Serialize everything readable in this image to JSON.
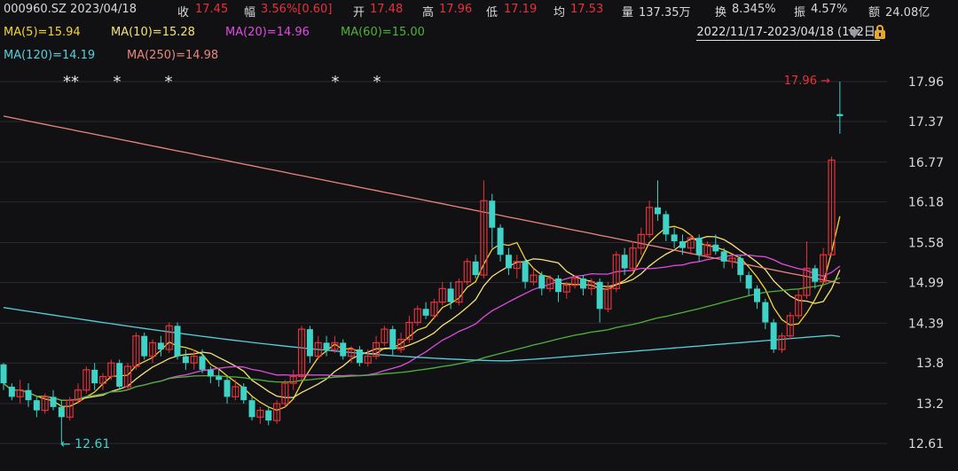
{
  "header": {
    "code_date": "000960.SZ 2023/04/18",
    "close": {
      "label": "收",
      "value": "17.45"
    },
    "change": {
      "label": "幅",
      "value": "3.56%[0.60]"
    },
    "open": {
      "label": "开",
      "value": "17.48"
    },
    "high": {
      "label": "高",
      "value": "17.96"
    },
    "low": {
      "label": "低",
      "value": "17.19"
    },
    "avg": {
      "label": "均",
      "value": "17.53"
    },
    "volume": {
      "label": "量",
      "value": "137.35万"
    },
    "turnover": {
      "label": "换",
      "value": "8.345%"
    },
    "amplitude": {
      "label": "振",
      "value": "4.57%"
    },
    "amount": {
      "label": "额",
      "value": "24.08亿"
    }
  },
  "ma_legend": [
    {
      "text": "MA(5)=15.94",
      "color": "#f3d23a"
    },
    {
      "text": "MA(10)=15.28",
      "color": "#f6e27a"
    },
    {
      "text": "MA(20)=14.96",
      "color": "#e04ce0"
    },
    {
      "text": "MA(60)=15.00",
      "color": "#4fb23a"
    },
    {
      "text": "MA(120)=14.19",
      "color": "#56d0dc"
    },
    {
      "text": "MA(250)=14.98",
      "color": "#e8877f"
    }
  ],
  "range_label": "2022/11/17-2023/04/18 (102日)",
  "colors": {
    "up": "#e8313a",
    "down": "#3fd2c7"
  },
  "chart_data": {
    "type": "candlestick",
    "y_ticks": [
      17.96,
      17.37,
      16.77,
      16.18,
      15.58,
      14.99,
      14.39,
      13.8,
      13.2,
      12.61
    ],
    "ylim": [
      12.61,
      17.96
    ],
    "high_marker": "17.96",
    "low_marker": "12.61",
    "star_labels": [
      "**",
      "*",
      "*",
      "*",
      "*"
    ],
    "candles": [
      [
        13.78,
        13.5,
        13.8,
        13.4
      ],
      [
        13.45,
        13.3,
        13.5,
        13.25
      ],
      [
        13.3,
        13.4,
        13.55,
        13.2
      ],
      [
        13.4,
        13.25,
        13.5,
        13.15
      ],
      [
        13.25,
        13.1,
        13.3,
        13.0
      ],
      [
        13.1,
        13.3,
        13.35,
        13.05
      ],
      [
        13.3,
        13.15,
        13.4,
        13.1
      ],
      [
        13.15,
        13.0,
        13.25,
        12.61
      ],
      [
        13.0,
        13.25,
        13.3,
        12.95
      ],
      [
        13.25,
        13.4,
        13.5,
        13.2
      ],
      [
        13.4,
        13.7,
        13.75,
        13.35
      ],
      [
        13.7,
        13.5,
        13.8,
        13.4
      ],
      [
        13.5,
        13.6,
        13.65,
        13.4
      ],
      [
        13.6,
        13.8,
        13.85,
        13.55
      ],
      [
        13.8,
        13.45,
        13.85,
        13.4
      ],
      [
        13.45,
        13.75,
        13.8,
        13.4
      ],
      [
        13.75,
        14.2,
        14.25,
        13.7
      ],
      [
        14.2,
        13.9,
        14.25,
        13.85
      ],
      [
        13.9,
        14.1,
        14.15,
        13.8
      ],
      [
        14.1,
        14.0,
        14.2,
        13.9
      ],
      [
        14.0,
        14.35,
        14.4,
        13.95
      ],
      [
        14.35,
        13.9,
        14.4,
        13.85
      ],
      [
        13.9,
        13.8,
        14.0,
        13.7
      ],
      [
        13.8,
        13.9,
        14.0,
        13.7
      ],
      [
        13.9,
        13.7,
        14.0,
        13.65
      ],
      [
        13.7,
        13.6,
        13.75,
        13.5
      ],
      [
        13.6,
        13.55,
        13.7,
        13.45
      ],
      [
        13.55,
        13.3,
        13.6,
        13.2
      ],
      [
        13.3,
        13.45,
        13.55,
        13.25
      ],
      [
        13.45,
        13.25,
        13.5,
        13.2
      ],
      [
        13.25,
        13.0,
        13.3,
        12.95
      ],
      [
        13.0,
        13.1,
        13.15,
        12.9
      ],
      [
        13.1,
        12.95,
        13.15,
        12.88
      ],
      [
        12.95,
        13.2,
        13.25,
        12.9
      ],
      [
        13.2,
        13.5,
        13.55,
        13.15
      ],
      [
        13.5,
        13.6,
        13.7,
        13.4
      ],
      [
        13.6,
        14.3,
        14.35,
        13.55
      ],
      [
        14.3,
        13.9,
        14.35,
        13.8
      ],
      [
        13.9,
        14.1,
        14.2,
        13.85
      ],
      [
        14.1,
        14.0,
        14.2,
        13.9
      ],
      [
        14.0,
        14.1,
        14.2,
        13.95
      ],
      [
        14.1,
        13.9,
        14.15,
        13.85
      ],
      [
        13.9,
        14.0,
        14.05,
        13.8
      ],
      [
        14.0,
        13.8,
        14.05,
        13.75
      ],
      [
        13.8,
        13.9,
        14.0,
        13.75
      ],
      [
        13.9,
        14.1,
        14.2,
        13.85
      ],
      [
        14.1,
        14.3,
        14.35,
        14.05
      ],
      [
        14.3,
        14.0,
        14.35,
        13.9
      ],
      [
        14.0,
        14.15,
        14.25,
        13.95
      ],
      [
        14.15,
        14.4,
        14.5,
        14.1
      ],
      [
        14.4,
        14.6,
        14.65,
        14.35
      ],
      [
        14.6,
        14.5,
        14.7,
        14.45
      ],
      [
        14.5,
        14.7,
        14.75,
        14.45
      ],
      [
        14.7,
        14.9,
        15.0,
        14.65
      ],
      [
        14.9,
        14.7,
        15.0,
        14.6
      ],
      [
        14.7,
        15.0,
        15.05,
        14.65
      ],
      [
        15.0,
        15.3,
        15.35,
        14.95
      ],
      [
        15.3,
        15.1,
        15.4,
        15.05
      ],
      [
        15.1,
        16.2,
        16.5,
        15.05
      ],
      [
        16.2,
        15.8,
        16.3,
        15.5
      ],
      [
        15.8,
        15.4,
        15.85,
        15.3
      ],
      [
        15.4,
        15.2,
        15.5,
        15.1
      ],
      [
        15.2,
        15.3,
        15.4,
        15.05
      ],
      [
        15.3,
        15.0,
        15.35,
        14.9
      ],
      [
        15.0,
        15.1,
        15.2,
        14.95
      ],
      [
        15.1,
        14.9,
        15.15,
        14.8
      ],
      [
        14.9,
        15.05,
        15.1,
        14.85
      ],
      [
        15.05,
        14.85,
        15.1,
        14.7
      ],
      [
        14.85,
        14.95,
        15.0,
        14.75
      ],
      [
        14.95,
        15.05,
        15.1,
        14.9
      ],
      [
        15.05,
        14.9,
        15.1,
        14.8
      ],
      [
        14.9,
        15.0,
        15.05,
        14.8
      ],
      [
        15.0,
        14.6,
        15.05,
        14.4
      ],
      [
        14.6,
        14.9,
        15.0,
        14.55
      ],
      [
        14.9,
        15.4,
        15.45,
        14.85
      ],
      [
        15.4,
        15.2,
        15.5,
        15.1
      ],
      [
        15.2,
        15.5,
        15.6,
        15.15
      ],
      [
        15.5,
        15.7,
        15.8,
        15.4
      ],
      [
        15.7,
        16.1,
        16.2,
        15.65
      ],
      [
        16.1,
        16.0,
        16.5,
        15.9
      ],
      [
        16.0,
        15.7,
        16.05,
        15.6
      ],
      [
        15.7,
        15.6,
        15.8,
        15.5
      ],
      [
        15.6,
        15.5,
        15.7,
        15.4
      ],
      [
        15.5,
        15.65,
        15.7,
        15.4
      ],
      [
        15.65,
        15.4,
        15.7,
        15.3
      ],
      [
        15.4,
        15.55,
        15.6,
        15.35
      ],
      [
        15.55,
        15.45,
        15.7,
        15.4
      ],
      [
        15.45,
        15.3,
        15.5,
        15.2
      ],
      [
        15.3,
        15.35,
        15.4,
        15.2
      ],
      [
        15.35,
        15.1,
        15.4,
        15.0
      ],
      [
        15.1,
        14.9,
        15.15,
        14.8
      ],
      [
        14.9,
        14.7,
        14.95,
        14.6
      ],
      [
        14.7,
        14.4,
        14.75,
        14.3
      ],
      [
        14.4,
        14.0,
        14.45,
        13.95
      ],
      [
        14.0,
        14.2,
        14.25,
        13.95
      ],
      [
        14.2,
        14.5,
        14.55,
        14.15
      ],
      [
        14.5,
        14.8,
        14.9,
        14.45
      ],
      [
        14.8,
        15.2,
        15.6,
        14.75
      ],
      [
        15.2,
        15.0,
        15.25,
        14.9
      ],
      [
        15.0,
        15.4,
        15.5,
        14.95
      ],
      [
        15.4,
        16.8,
        16.85,
        15.4
      ],
      [
        17.48,
        17.45,
        17.96,
        17.19
      ]
    ]
  }
}
